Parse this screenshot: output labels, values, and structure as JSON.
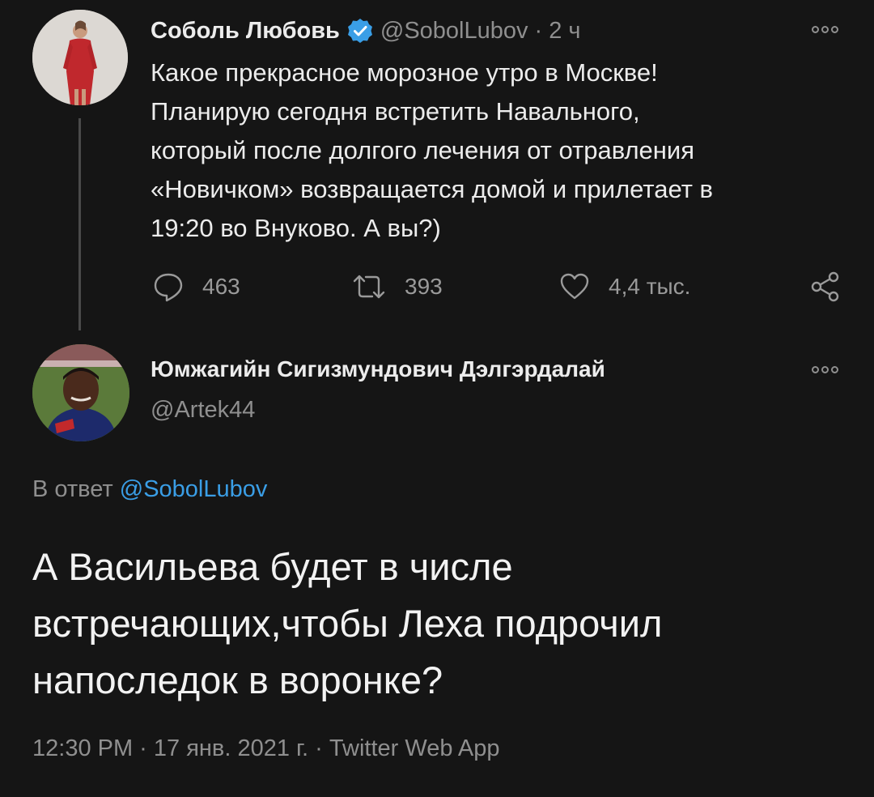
{
  "parent_tweet": {
    "author_name": "Соболь Любовь",
    "handle": "@SobolLubov",
    "separator": "·",
    "time_ago": "2 ч",
    "text_lines": [
      "Какое прекрасное морозное утро в Москве!",
      "Планирую сегодня встретить Навального,",
      "который после долгого лечения от отравления",
      "«Новичком» возвращается домой и прилетает в",
      "19:20 во Внуково. А вы?)"
    ],
    "replies_count": "463",
    "retweets_count": "393",
    "likes_count": "4,4 тыс."
  },
  "reply_tweet": {
    "author_name": "Юмжагийн Сигизмундович Дэлгэрдалай",
    "handle": "@Artek44",
    "in_reply_prefix": "В ответ",
    "in_reply_mention": "@SobolLubov",
    "text_lines": [
      "А Васильева будет в числе",
      "встречающих,чтобы Леха подрочил",
      "напоследок в воронке?"
    ],
    "footer": "12:30 PM · 17 янв. 2021 г. · Twitter Web App"
  },
  "colors": {
    "background": "#151515",
    "link": "#3a9ee6",
    "verified_badge": "#3a9ee6",
    "muted_text": "#8f8f8f"
  }
}
